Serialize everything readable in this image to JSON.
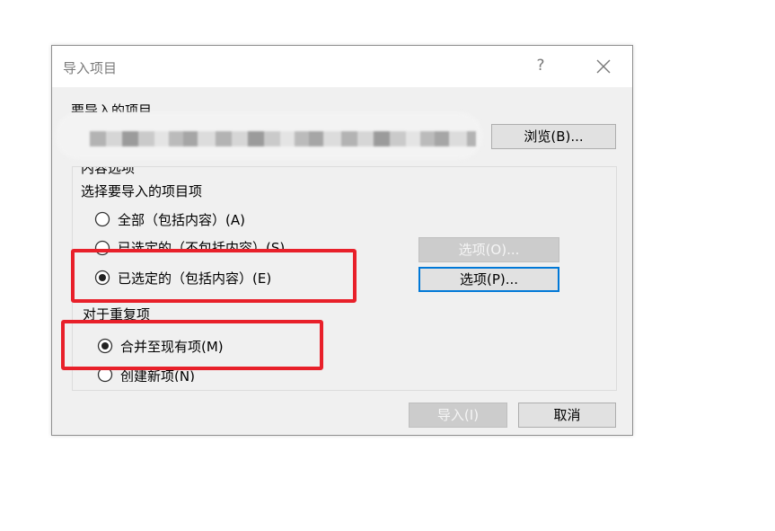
{
  "dialog": {
    "title": "导入项目",
    "help_glyph": "?",
    "items_label": "要导入的项目",
    "browse_label": "浏览(B)...",
    "content_group_label": "内容选项",
    "select_label": "选择要导入的项目项",
    "options": [
      {
        "label": "全部（包括内容）(A)",
        "checked": false
      },
      {
        "label": "已选定的（不包括内容）(S)",
        "checked": false
      },
      {
        "label": "已选定的（包括内容）(E)",
        "checked": true
      }
    ],
    "options_o_label": "选项(O)...",
    "options_p_label": "选项(P)...",
    "duplicates_label": "对于重复项",
    "dup_options": [
      {
        "label": "合并至现有项(M)",
        "checked": true
      },
      {
        "label": "创建新项(N)",
        "checked": false
      }
    ],
    "import_label": "导入(I)",
    "cancel_label": "取消"
  },
  "colors": {
    "accent": "#0078d7",
    "highlight": "#e8202a",
    "dialog_bg": "#f0f0f0"
  },
  "icons": {
    "help": "help-icon",
    "close": "close-icon"
  }
}
